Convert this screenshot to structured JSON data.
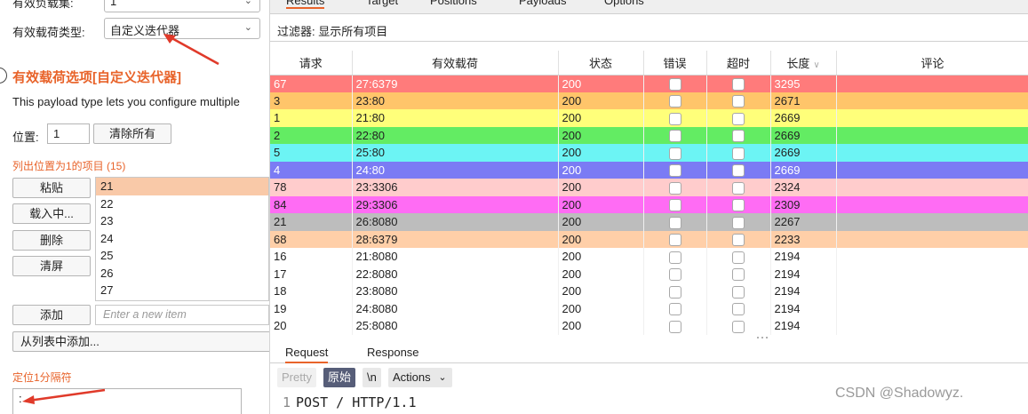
{
  "left": {
    "payload_count_label": "有效负载集:",
    "payload_count_value": "1",
    "payload_type_label": "有效载荷类型:",
    "payload_type_value": "自定义迭代器",
    "section_title": "有效载荷选项[自定义迭代器]",
    "description": "This payload type lets you configure multiple",
    "position_label": "位置:",
    "position_value": "1",
    "clear_all_label": "清除所有",
    "list_heading": "列出位置为1的项目 (15)",
    "buttons": {
      "paste": "粘贴",
      "load": "载入中...",
      "remove": "删除",
      "clear": "清屏",
      "add": "添加",
      "add_from_list": "从列表中添加..."
    },
    "list_items": [
      "21",
      "22",
      "23",
      "24",
      "25",
      "26",
      "27"
    ],
    "new_item_placeholder": "Enter a new item",
    "separator_label": "定位1分隔符",
    "separator_value": ":"
  },
  "right": {
    "tabs": [
      "Results",
      "Target",
      "Positions",
      "Payloads",
      "Options"
    ],
    "filter_text": "过滤器:  显示所有项目",
    "columns": [
      "请求",
      "有效载荷",
      "状态",
      "错误",
      "超时",
      "长度",
      "评论"
    ],
    "rows": [
      {
        "req": "67",
        "payload": "27:6379",
        "status": "200",
        "length": "3295",
        "color": "#ff7b7b",
        "text": "#ffffff"
      },
      {
        "req": "3",
        "payload": "23:80",
        "status": "200",
        "length": "2671",
        "color": "#ffc56a",
        "text": "#222222"
      },
      {
        "req": "1",
        "payload": "21:80",
        "status": "200",
        "length": "2669",
        "color": "#ffff7a",
        "text": "#222222"
      },
      {
        "req": "2",
        "payload": "22:80",
        "status": "200",
        "length": "2669",
        "color": "#63ec63",
        "text": "#222222"
      },
      {
        "req": "5",
        "payload": "25:80",
        "status": "200",
        "length": "2669",
        "color": "#6cf4f4",
        "text": "#222222"
      },
      {
        "req": "4",
        "payload": "24:80",
        "status": "200",
        "length": "2669",
        "color": "#7b7bf4",
        "text": "#ffffff"
      },
      {
        "req": "78",
        "payload": "23:3306",
        "status": "200",
        "length": "2324",
        "color": "#ffcccc",
        "text": "#222222"
      },
      {
        "req": "84",
        "payload": "29:3306",
        "status": "200",
        "length": "2309",
        "color": "#ff6cf4",
        "text": "#222222"
      },
      {
        "req": "21",
        "payload": "26:8080",
        "status": "200",
        "length": "2267",
        "color": "#bdbdbd",
        "text": "#222222"
      },
      {
        "req": "68",
        "payload": "28:6379",
        "status": "200",
        "length": "2233",
        "color": "#ffcfa8",
        "text": "#222222"
      },
      {
        "req": "16",
        "payload": "21:8080",
        "status": "200",
        "length": "2194",
        "color": "#ffffff",
        "text": "#222222"
      },
      {
        "req": "17",
        "payload": "22:8080",
        "status": "200",
        "length": "2194",
        "color": "#ffffff",
        "text": "#222222"
      },
      {
        "req": "18",
        "payload": "23:8080",
        "status": "200",
        "length": "2194",
        "color": "#ffffff",
        "text": "#222222"
      },
      {
        "req": "19",
        "payload": "24:8080",
        "status": "200",
        "length": "2194",
        "color": "#ffffff",
        "text": "#222222"
      },
      {
        "req": "20",
        "payload": "25:8080",
        "status": "200",
        "length": "2194",
        "color": "#ffffff",
        "text": "#222222"
      }
    ],
    "req_tabs": [
      "Request",
      "Response"
    ],
    "editor": {
      "pretty": "Pretty",
      "raw": "原始",
      "newline": "\\n",
      "actions": "Actions"
    },
    "code_line_number": "1",
    "code_line": "POST / HTTP/1.1"
  },
  "watermark": "CSDN @Shadowyz.",
  "colors": {
    "accent": "#e8632a",
    "arrow": "#e03a2a"
  }
}
